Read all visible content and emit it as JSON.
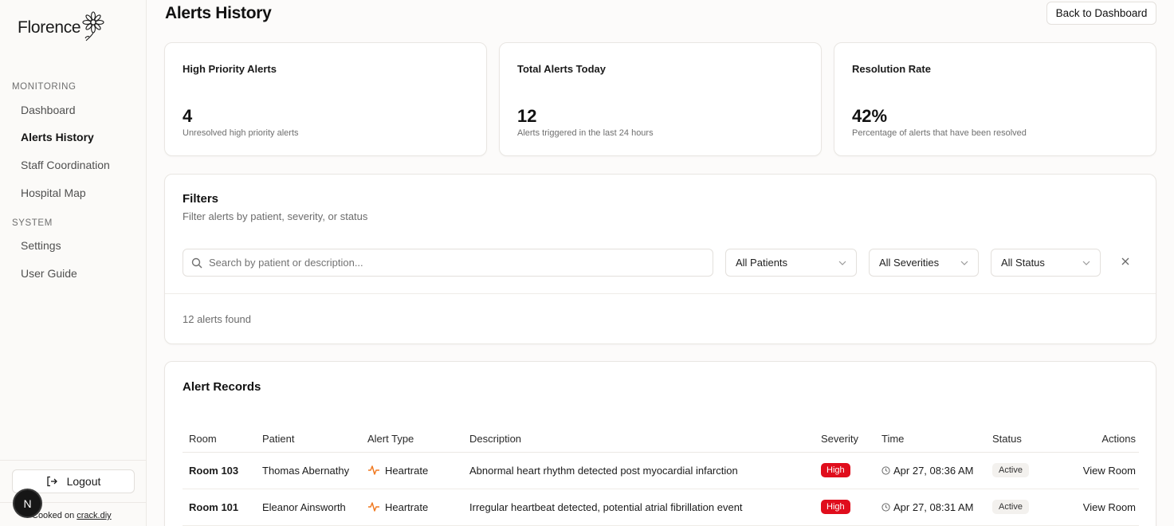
{
  "app": {
    "name": "Florence"
  },
  "sidebar": {
    "sections": [
      {
        "label": "MONITORING",
        "items": [
          "Dashboard",
          "Alerts History",
          "Staff Coordination",
          "Hospital Map"
        ]
      },
      {
        "label": "SYSTEM",
        "items": [
          "Settings",
          "User Guide"
        ]
      }
    ],
    "active_item": "Alerts History",
    "logout_label": "Logout",
    "avatar_letter": "N",
    "cooked_prefix": "Cooked on ",
    "cooked_link": "crack.diy"
  },
  "header": {
    "title": "Alerts History",
    "back_button": "Back to Dashboard"
  },
  "stats": [
    {
      "title": "High Priority Alerts",
      "value": "4",
      "subtitle": "Unresolved high priority alerts"
    },
    {
      "title": "Total Alerts Today",
      "value": "12",
      "subtitle": "Alerts triggered in the last 24 hours"
    },
    {
      "title": "Resolution Rate",
      "value": "42%",
      "subtitle": "Percentage of alerts that have been resolved"
    }
  ],
  "filters": {
    "title": "Filters",
    "description": "Filter alerts by patient, severity, or status",
    "search_placeholder": "Search by patient or description...",
    "patients_select": "All Patients",
    "severities_select": "All Severities",
    "status_select": "All Status",
    "results_text": "12 alerts found"
  },
  "records": {
    "title": "Alert Records",
    "columns": [
      "Room",
      "Patient",
      "Alert Type",
      "Description",
      "Severity",
      "Time",
      "Status",
      "Actions"
    ],
    "rows": [
      {
        "room": "Room 103",
        "patient": "Thomas Abernathy",
        "type": "Heartrate",
        "description": "Abnormal heart rhythm detected post myocardial infarction",
        "severity": "High",
        "time": "Apr 27, 08:36 AM",
        "status": "Active",
        "action": "View Room"
      },
      {
        "room": "Room 101",
        "patient": "Eleanor Ainsworth",
        "type": "Heartrate",
        "description": "Irregular heartbeat detected, potential atrial fibrillation event",
        "severity": "High",
        "time": "Apr 27, 08:31 AM",
        "status": "Active",
        "action": "View Room"
      }
    ]
  },
  "colors": {
    "severity_high": "#e00d1c",
    "heartrate_icon": "#f07a22",
    "background": "#fcfbfa"
  }
}
